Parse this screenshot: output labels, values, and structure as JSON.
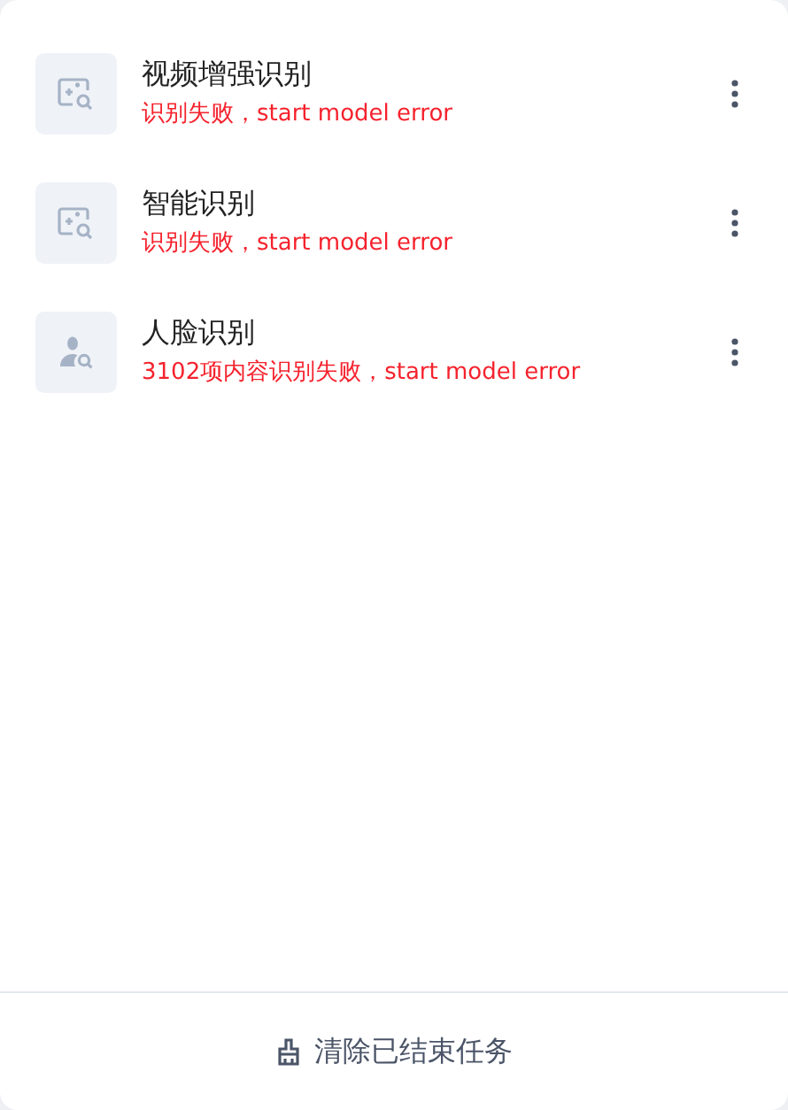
{
  "tasks": [
    {
      "kind": "image",
      "title": "视频增强识别",
      "status": "识别失败，start model error"
    },
    {
      "kind": "image",
      "title": "智能识别",
      "status": "识别失败，start model error"
    },
    {
      "kind": "face",
      "title": "人脸识别",
      "status": "3102项内容识别失败，start model error"
    }
  ],
  "footer": {
    "button": "清除已结束任务"
  }
}
